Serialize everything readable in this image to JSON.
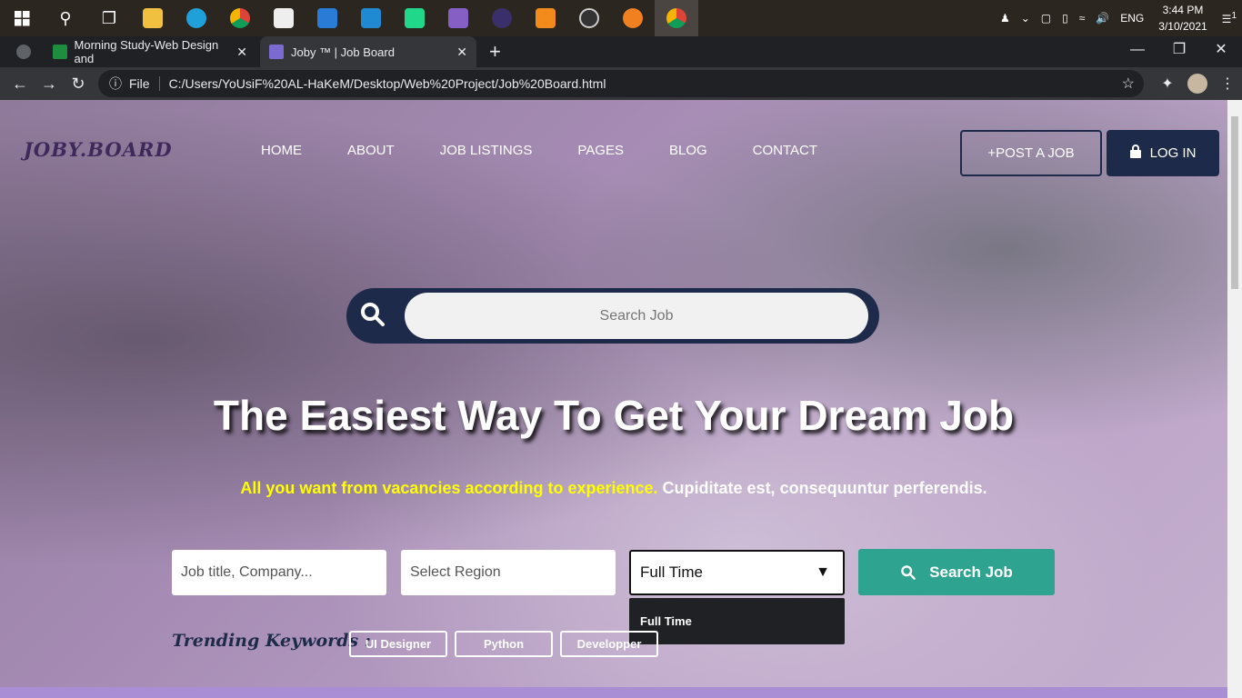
{
  "taskbar": {
    "apps": [
      "windows-start",
      "search",
      "task-view",
      "file-explorer",
      "edge",
      "chrome",
      "store",
      "mail",
      "vscode",
      "pycharm",
      "visual-studio",
      "eclipse",
      "sublime",
      "obs",
      "spark",
      "chrome-active"
    ],
    "tray": {
      "lang": "ENG",
      "time": "3:44 PM",
      "date": "3/10/2021",
      "notifications": "1"
    }
  },
  "browser": {
    "tabs": [
      {
        "title": "Morning Study-Web Design and",
        "active": false
      },
      {
        "title": "Joby ™ | Job Board",
        "active": true
      }
    ],
    "address_prefix": "File",
    "url": "C:/Users/YoUsiF%20AL-HaKeM/Desktop/Web%20Project/Job%20Board.html"
  },
  "site": {
    "brand": "JOBY.BOARD",
    "nav": [
      "HOME",
      "ABOUT",
      "JOB LISTINGS",
      "PAGES",
      "BLOG",
      "CONTACT"
    ],
    "post_job": "+POST A JOB",
    "login": "LOG IN",
    "top_search_placeholder": "Search Job",
    "hero_title": "The Easiest Way To Get Your Dream Job",
    "subtitle_highlight": "All you want from vacancies according to experience.",
    "subtitle_rest": " Cupiditate est, consequuntur perferendis.",
    "search_form": {
      "job_placeholder": "Job title, Company...",
      "region_placeholder": "Select Region",
      "type_value": "Full Time",
      "dropdown_option": "Full Time",
      "search_button": "Search Job"
    },
    "trending_label": "Trending Keywords :",
    "keywords": [
      "UI Designer",
      "Python",
      "Developper"
    ]
  },
  "colors": {
    "accent": "#2ea38f",
    "navy": "#1e2a4a",
    "highlight": "#ffff00"
  }
}
